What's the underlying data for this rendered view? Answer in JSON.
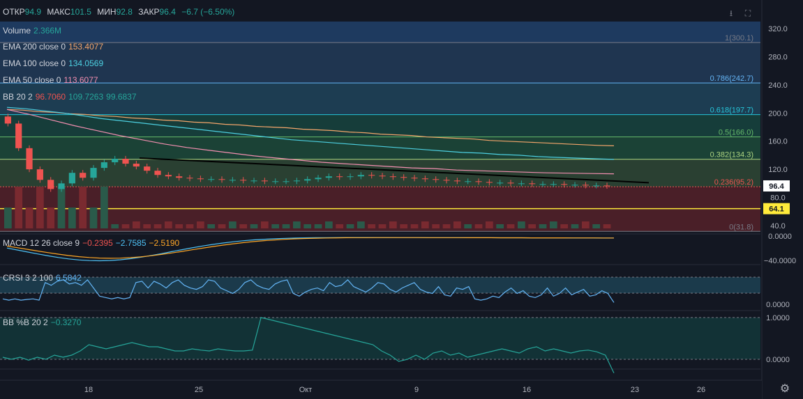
{
  "header": {
    "open_label": "ОТКР",
    "open_value": "94.9",
    "high_label": "МАКС",
    "high_value": "101.5",
    "low_label": "МИН",
    "low_value": "92.8",
    "close_label": "ЗАКР",
    "close_value": "96.4",
    "change": "−6.7 (−6.50%)"
  },
  "indicators": {
    "volume": {
      "label": "Volume",
      "value": "2.366M",
      "color": "#26a69a"
    },
    "ema200": {
      "label": "EMA 200 close 0",
      "value": "153.4077",
      "color": "#f5a66b"
    },
    "ema100": {
      "label": "EMA 100 close 0",
      "value": "134.0569",
      "color": "#4dd0e1"
    },
    "ema50": {
      "label": "EMA 50 close 0",
      "value": "113.6077",
      "color": "#f48fb1"
    },
    "bb": {
      "label": "BB 20 2",
      "values": [
        "96.7060",
        "109.7263",
        "99.6837"
      ],
      "colors": [
        "#ef5350",
        "#26a69a",
        "#26a69a"
      ]
    },
    "macd": {
      "label": "MACD 12 26 close 9",
      "values": [
        "−0.2395",
        "−2.7585",
        "−2.5190"
      ],
      "colors": [
        "#ef5350",
        "#4fc3f7",
        "#ffa726"
      ]
    },
    "crsi": {
      "label": "CRSI 3 2 100",
      "value": "6.5842",
      "color": "#64b5f6"
    },
    "bbpctb": {
      "label": "BB %B 20 2",
      "value": "−0.3270",
      "color": "#26a69a"
    }
  },
  "chart_data": {
    "type": "candlestick",
    "price_axis": {
      "ticks": [
        "320.0",
        "280.0",
        "240.0",
        "200.0",
        "160.0",
        "120.0",
        "80.0",
        "40.0"
      ],
      "ylim": [
        40,
        330
      ]
    },
    "time_axis": {
      "ticks": [
        "18",
        "25",
        "Окт",
        "9",
        "16",
        "23",
        "26"
      ]
    },
    "fib_levels": [
      {
        "label": "1(300.1)",
        "value": 300.1,
        "color": "#787b86"
      },
      {
        "label": "0.786(242.7)",
        "value": 242.7,
        "color": "#64b5f6"
      },
      {
        "label": "0.618(197.7)",
        "value": 197.7,
        "color": "#26c6da"
      },
      {
        "label": "0.5(166.0)",
        "value": 166.0,
        "color": "#66bb6a"
      },
      {
        "label": "0.382(134.3)",
        "value": 134.3,
        "color": "#aed581"
      },
      {
        "label": "0.236(95.2)",
        "value": 95.2,
        "color": "#ef5350"
      },
      {
        "label": "0(31.8)",
        "value": 31.8,
        "color": "#787b86"
      }
    ],
    "price_badges": [
      {
        "label": "96.4",
        "value": 96.4,
        "bg": "#ffffff",
        "fg": "#131722"
      },
      {
        "label": "64.1",
        "value": 64.1,
        "bg": "#ffeb3b",
        "fg": "#131722"
      }
    ],
    "horizontal_line": 64.1,
    "closes": [
      185,
      150,
      120,
      105,
      92,
      100,
      115,
      108,
      122,
      130,
      135,
      128,
      124,
      118,
      112,
      110,
      108,
      107,
      106,
      106,
      105,
      105,
      104,
      104,
      103,
      103,
      103,
      104,
      106,
      108,
      110,
      109,
      110,
      112,
      111,
      110,
      109,
      108,
      107,
      106,
      105,
      104,
      103,
      103,
      102,
      101,
      101,
      100,
      100,
      99,
      99,
      99,
      98,
      98,
      97,
      97,
      96.4
    ],
    "ema200": [
      205,
      204,
      202,
      201,
      199,
      198,
      196,
      195,
      193,
      192,
      190,
      189,
      187,
      186,
      184,
      183,
      181,
      180,
      179,
      177,
      176,
      175,
      173,
      172,
      170,
      169,
      168,
      166,
      165,
      164,
      163,
      161,
      160,
      159,
      158,
      157,
      156,
      155,
      154,
      153.4
    ],
    "ema100": [
      208,
      206,
      203,
      200,
      196,
      192,
      189,
      186,
      183,
      180,
      177,
      174,
      171,
      168,
      165,
      162,
      160,
      158,
      156,
      154,
      152,
      150,
      148,
      146,
      144,
      143,
      141,
      140,
      138,
      137,
      136,
      135,
      134.1
    ],
    "ema50": [
      205,
      198,
      190,
      182,
      175,
      168,
      162,
      156,
      151,
      147,
      143,
      139,
      136,
      133,
      130,
      128,
      126,
      124,
      122,
      121,
      119,
      118,
      117,
      116,
      115,
      114.5,
      114,
      113.6
    ],
    "macd": {
      "ylim": [
        -50,
        10
      ],
      "ticks": [
        "0.0000",
        "−40.0000"
      ]
    },
    "crsi": {
      "ylim": [
        0,
        100
      ],
      "ticks": [
        "0.0000"
      ],
      "values": [
        20,
        15,
        20,
        15,
        18,
        20,
        15,
        80,
        70,
        85,
        90,
        75,
        80,
        70,
        90,
        60,
        30,
        25,
        20,
        25,
        20,
        25,
        80,
        85,
        60,
        85,
        75,
        60,
        80,
        90,
        70,
        60,
        55,
        65,
        90,
        85,
        60,
        50,
        40,
        55,
        80,
        90,
        70,
        60,
        55,
        75,
        85,
        90,
        40,
        30,
        45,
        55,
        60,
        50,
        80,
        65,
        70,
        90,
        65,
        55,
        45,
        60,
        80,
        75,
        55,
        45,
        60,
        70,
        80,
        55,
        45,
        40,
        65,
        35,
        30,
        60,
        55,
        65,
        20,
        15,
        20,
        30,
        25,
        45,
        60,
        40,
        50,
        30,
        25,
        35,
        60,
        30,
        40,
        60,
        35,
        45,
        55,
        30,
        35,
        50,
        40,
        6.6
      ]
    },
    "bbpctb": {
      "ylim": [
        -0.5,
        1.1
      ],
      "ticks": [
        "1.0000",
        "0.0000"
      ],
      "values": [
        0.05,
        0.0,
        0.05,
        -0.02,
        0.05,
        0.0,
        0.1,
        0.05,
        0.1,
        0.2,
        0.35,
        0.3,
        0.25,
        0.3,
        0.35,
        0.4,
        0.35,
        0.3,
        0.3,
        0.25,
        0.2,
        0.2,
        0.25,
        0.22,
        0.2,
        0.25,
        0.22,
        0.2,
        0.2,
        0.22,
        1.0,
        0.95,
        0.9,
        0.85,
        0.8,
        0.75,
        0.7,
        0.65,
        0.6,
        0.55,
        0.5,
        0.45,
        0.4,
        0.35,
        0.2,
        0.1,
        -0.05,
        0.0,
        0.1,
        0.0,
        0.15,
        0.2,
        0.1,
        0.15,
        0.05,
        0.1,
        0.15,
        0.2,
        0.25,
        0.2,
        0.15,
        0.25,
        0.3,
        0.2,
        0.25,
        0.2,
        0.15,
        0.2,
        0.22,
        0.18,
        0.1,
        -0.33
      ]
    }
  }
}
